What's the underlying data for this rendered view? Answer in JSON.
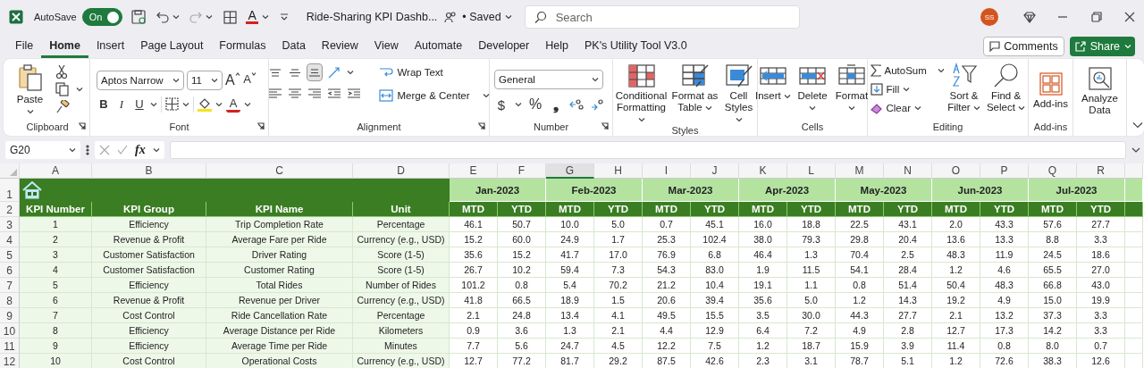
{
  "title_bar": {
    "autosave_label": "AutoSave",
    "autosave_toggle": {
      "label": "On",
      "on": true
    },
    "font_color_letter": "A",
    "document_title": "Ride-Sharing KPI Dashb...",
    "save_status": "• Saved",
    "search": {
      "placeholder": "Search"
    },
    "avatar": "SS"
  },
  "menu_tabs": [
    {
      "label": "File",
      "selected": false
    },
    {
      "label": "Home",
      "selected": true
    },
    {
      "label": "Insert",
      "selected": false
    },
    {
      "label": "Page Layout",
      "selected": false
    },
    {
      "label": "Formulas",
      "selected": false
    },
    {
      "label": "Data",
      "selected": false
    },
    {
      "label": "Review",
      "selected": false
    },
    {
      "label": "View",
      "selected": false
    },
    {
      "label": "Automate",
      "selected": false
    },
    {
      "label": "Developer",
      "selected": false
    },
    {
      "label": "Help",
      "selected": false
    },
    {
      "label": "PK's Utility Tool V3.0",
      "selected": false
    }
  ],
  "comments_button": "Comments",
  "share_button": "Share",
  "ribbon": {
    "groups": [
      {
        "kind": "clipboard",
        "name": "Clipboard",
        "buttons": [
          "Paste"
        ]
      },
      {
        "kind": "font",
        "name": "Font",
        "font_name": "Aptos Narrow",
        "font_size": "11",
        "size_letters": [
          "A",
          "A"
        ],
        "style_letters": [
          "B",
          "I",
          "U"
        ],
        "font_color_letter": "A"
      },
      {
        "kind": "alignment",
        "name": "Alignment",
        "vertical_align": [
          {
            "selected": false
          },
          {
            "selected": false
          },
          {
            "selected": true
          }
        ],
        "buttons": [
          "Wrap Text",
          "Merge & Center"
        ]
      },
      {
        "kind": "number",
        "name": "Number",
        "format": "General",
        "symbols": [
          "$",
          "%",
          "❟"
        ]
      },
      {
        "kind": "styles",
        "name": "Styles",
        "buttons": [
          "Conditional Formatting",
          "Format as Table",
          "Cell Styles"
        ]
      },
      {
        "kind": "cells",
        "name": "Cells",
        "buttons": [
          "Insert",
          "Delete",
          "Format"
        ]
      },
      {
        "kind": "editing",
        "name": "Editing",
        "buttons": [
          "AutoSum",
          "Fill",
          "Clear",
          "Sort & Filter",
          "Find & Select"
        ]
      },
      {
        "kind": "addins",
        "name": "Add-ins",
        "buttons": [
          "Add-ins"
        ]
      },
      {
        "kind": "analyze",
        "buttons": [
          "Analyze Data"
        ]
      }
    ]
  },
  "formula_bar": {
    "name_box": "G20",
    "function_label": "fx"
  },
  "sheet": {
    "columns": [
      {
        "label": "A",
        "selected": false
      },
      {
        "label": "B",
        "selected": false
      },
      {
        "label": "C",
        "selected": false
      },
      {
        "label": "D",
        "selected": false
      },
      {
        "label": "E",
        "selected": false
      },
      {
        "label": "F",
        "selected": false
      },
      {
        "label": "G",
        "selected": true
      },
      {
        "label": "H",
        "selected": false
      },
      {
        "label": "I",
        "selected": false
      },
      {
        "label": "J",
        "selected": false
      },
      {
        "label": "K",
        "selected": false
      },
      {
        "label": "L",
        "selected": false
      },
      {
        "label": "M",
        "selected": false
      },
      {
        "label": "N",
        "selected": false
      },
      {
        "label": "O",
        "selected": false
      },
      {
        "label": "P",
        "selected": false
      },
      {
        "label": "Q",
        "selected": false
      },
      {
        "label": "R",
        "selected": false
      }
    ],
    "row_numbers": [
      "1",
      "2",
      "3",
      "4",
      "5",
      "6",
      "7",
      "8",
      "9",
      "10",
      "11",
      "12"
    ],
    "months": [
      "Jan-2023",
      "Feb-2023",
      "Mar-2023",
      "Apr-2023",
      "May-2023",
      "Jun-2023",
      "Jul-2023"
    ],
    "headers": [
      "KPI Number",
      "KPI Group",
      "KPI Name",
      "Unit",
      "MTD",
      "YTD",
      "MTD",
      "YTD",
      "MTD",
      "YTD",
      "MTD",
      "YTD",
      "MTD",
      "YTD",
      "MTD",
      "YTD",
      "MTD",
      "YTD"
    ],
    "rows": [
      {
        "cells": [
          "1",
          "Efficiency",
          "Trip Completion Rate",
          "Percentage",
          "46.1",
          "50.7",
          "10.0",
          "5.0",
          "0.7",
          "45.1",
          "16.0",
          "18.8",
          "22.5",
          "43.1",
          "2.0",
          "43.3",
          "57.6",
          "27.7"
        ]
      },
      {
        "cells": [
          "2",
          "Revenue & Profit",
          "Average Fare per Ride",
          "Currency (e.g., USD)",
          "15.2",
          "60.0",
          "24.9",
          "1.7",
          "25.3",
          "102.4",
          "38.0",
          "79.3",
          "29.8",
          "20.4",
          "13.6",
          "13.3",
          "8.8",
          "3.3"
        ]
      },
      {
        "cells": [
          "3",
          "Customer Satisfaction",
          "Driver Rating",
          "Score (1-5)",
          "35.6",
          "15.2",
          "41.7",
          "17.0",
          "76.9",
          "6.8",
          "46.4",
          "1.3",
          "70.4",
          "2.5",
          "48.3",
          "11.9",
          "24.5",
          "18.6"
        ]
      },
      {
        "cells": [
          "4",
          "Customer Satisfaction",
          "Customer Rating",
          "Score (1-5)",
          "26.7",
          "10.2",
          "59.4",
          "7.3",
          "54.3",
          "83.0",
          "1.9",
          "11.5",
          "54.1",
          "28.4",
          "1.2",
          "4.6",
          "65.5",
          "27.0"
        ]
      },
      {
        "cells": [
          "5",
          "Efficiency",
          "Total Rides",
          "Number of Rides",
          "101.2",
          "0.8",
          "5.4",
          "70.2",
          "21.2",
          "10.4",
          "19.1",
          "1.1",
          "0.8",
          "51.4",
          "50.4",
          "48.3",
          "66.8",
          "43.0"
        ]
      },
      {
        "cells": [
          "6",
          "Revenue & Profit",
          "Revenue per Driver",
          "Currency (e.g., USD)",
          "41.8",
          "66.5",
          "18.9",
          "1.5",
          "20.6",
          "39.4",
          "35.6",
          "5.0",
          "1.2",
          "14.3",
          "19.2",
          "4.9",
          "15.0",
          "19.9"
        ]
      },
      {
        "cells": [
          "7",
          "Cost Control",
          "Ride Cancellation Rate",
          "Percentage",
          "2.1",
          "24.8",
          "13.4",
          "4.1",
          "49.5",
          "15.5",
          "3.5",
          "30.0",
          "44.3",
          "27.7",
          "2.1",
          "13.2",
          "37.3",
          "3.3"
        ]
      },
      {
        "cells": [
          "8",
          "Efficiency",
          "Average Distance per Ride",
          "Kilometers",
          "0.9",
          "3.6",
          "1.3",
          "2.1",
          "4.4",
          "12.9",
          "6.4",
          "7.2",
          "4.9",
          "2.8",
          "12.7",
          "17.3",
          "14.2",
          "3.3"
        ]
      },
      {
        "cells": [
          "9",
          "Efficiency",
          "Average Time per Ride",
          "Minutes",
          "7.7",
          "5.6",
          "24.7",
          "4.5",
          "12.2",
          "7.5",
          "1.2",
          "18.7",
          "15.9",
          "3.9",
          "11.4",
          "0.8",
          "8.0",
          "0.7"
        ]
      },
      {
        "cells": [
          "10",
          "Cost Control",
          "Operational Costs",
          "Currency (e.g., USD)",
          "12.7",
          "77.2",
          "81.7",
          "29.2",
          "87.5",
          "42.6",
          "2.3",
          "3.1",
          "78.7",
          "5.1",
          "1.2",
          "72.6",
          "38.3",
          "12.6"
        ]
      }
    ]
  }
}
